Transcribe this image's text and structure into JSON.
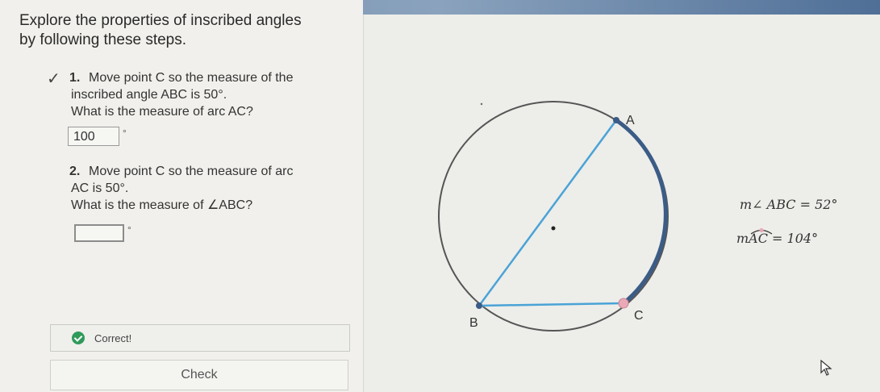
{
  "instructions": {
    "line1": "Explore the properties of inscribed angles",
    "line2": "by following these steps."
  },
  "step1": {
    "number": "1.",
    "line1": "Move point C so the measure of the",
    "line2": "inscribed angle ABC is 50°.",
    "question": "What is the measure of arc AC?",
    "answer_value": "100",
    "unit": "°",
    "completed": true
  },
  "step2": {
    "number": "2.",
    "line1": "Move point C so the measure of arc",
    "line2": "AC is 50°.",
    "question": "What is the measure of ∠ABC?",
    "answer_value": "",
    "unit": "°"
  },
  "feedback": {
    "label": "Correct!",
    "status_color": "#2f9a5a"
  },
  "check_button": {
    "label": "Check"
  },
  "diagram": {
    "point_labels": {
      "a": "A",
      "b": "B",
      "c": "C"
    },
    "angle_measure": "m∠ ABC = 52°",
    "arc_measure_prefix": "m",
    "arc_measure_label": "AC",
    "arc_measure_suffix": " = 104°",
    "arc_color": "#3b5c86",
    "chord_color": "#4aa3d6",
    "point_c_color": "#e9a9b6"
  }
}
